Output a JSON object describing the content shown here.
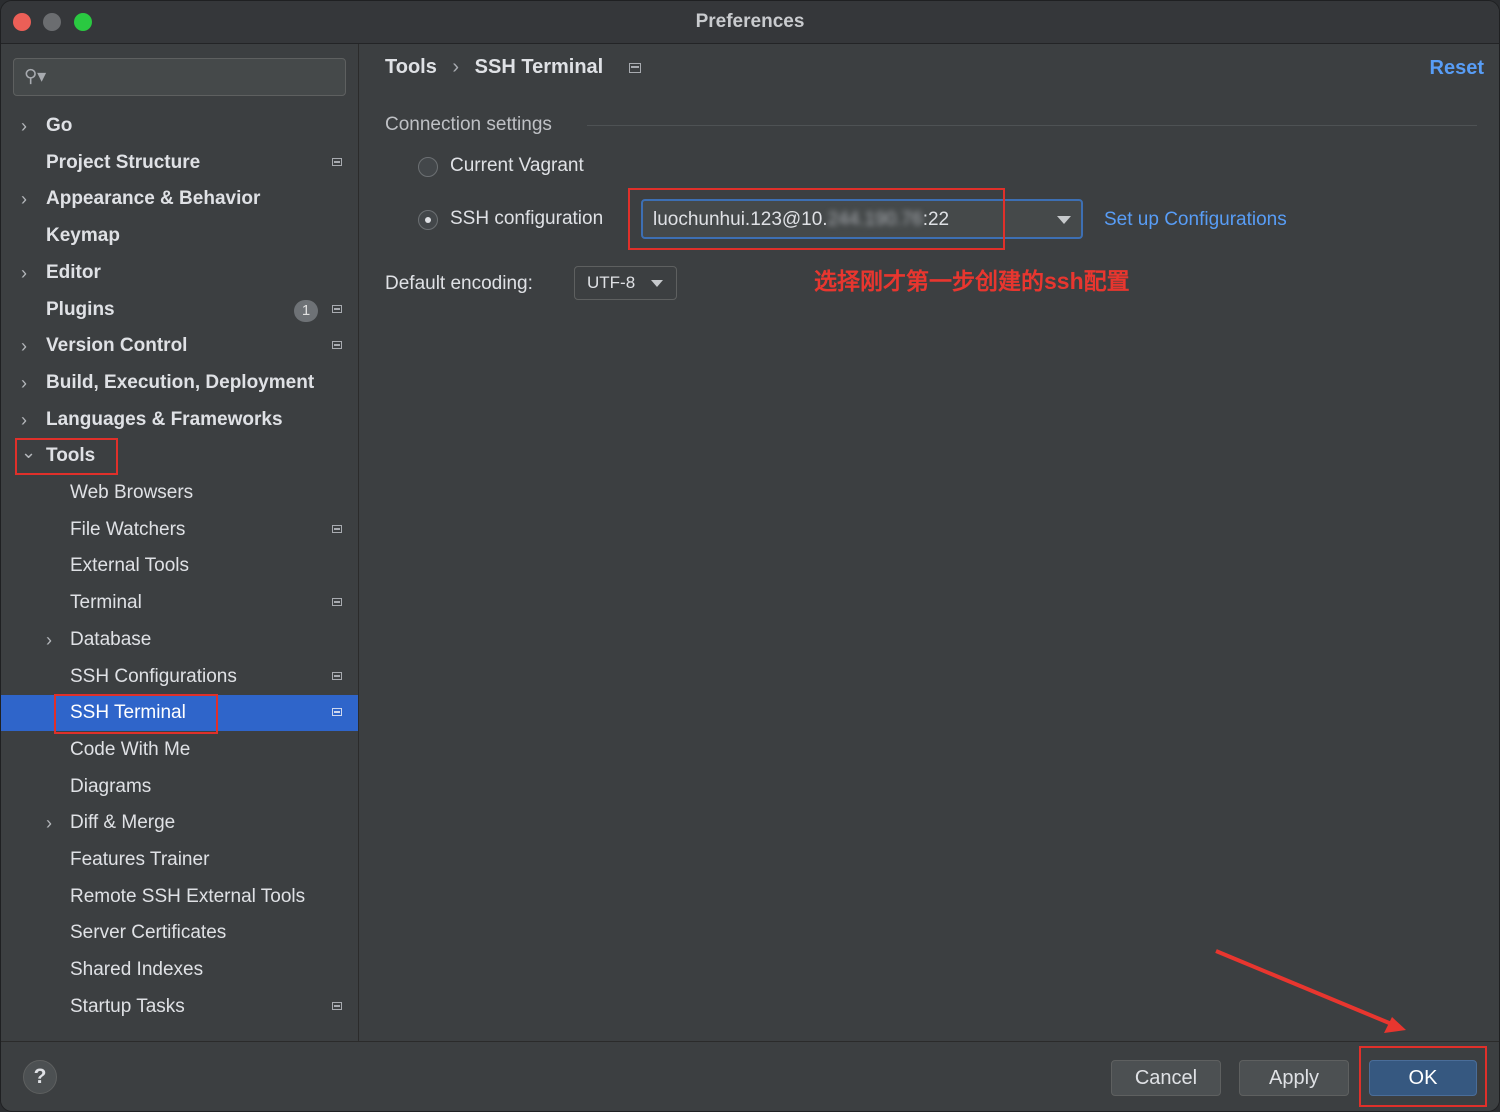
{
  "window": {
    "title": "Preferences"
  },
  "search": {
    "placeholder": ""
  },
  "sidebar": {
    "items": [
      {
        "label": "Go",
        "level": 0,
        "expander": "›",
        "icon": false
      },
      {
        "label": "Project Structure",
        "level": 0,
        "expander": "",
        "icon": true
      },
      {
        "label": "Appearance & Behavior",
        "level": 0,
        "expander": "›",
        "icon": false
      },
      {
        "label": "Keymap",
        "level": 0,
        "expander": "",
        "icon": false
      },
      {
        "label": "Editor",
        "level": 0,
        "expander": "›",
        "icon": false
      },
      {
        "label": "Plugins",
        "level": 0,
        "expander": "",
        "icon": true,
        "badge": "1"
      },
      {
        "label": "Version Control",
        "level": 0,
        "expander": "›",
        "icon": true
      },
      {
        "label": "Build, Execution, Deployment",
        "level": 0,
        "expander": "›",
        "icon": false
      },
      {
        "label": "Languages & Frameworks",
        "level": 0,
        "expander": "›",
        "icon": false
      },
      {
        "label": "Tools",
        "level": 0,
        "expander": "⌄",
        "icon": false
      },
      {
        "label": "Web Browsers",
        "level": 1,
        "expander": "",
        "icon": false
      },
      {
        "label": "File Watchers",
        "level": 1,
        "expander": "",
        "icon": true
      },
      {
        "label": "External Tools",
        "level": 1,
        "expander": "",
        "icon": false
      },
      {
        "label": "Terminal",
        "level": 1,
        "expander": "",
        "icon": true
      },
      {
        "label": "Database",
        "level": 1,
        "expander": "›",
        "icon": false
      },
      {
        "label": "SSH Configurations",
        "level": 1,
        "expander": "",
        "icon": true
      },
      {
        "label": "SSH Terminal",
        "level": 1,
        "expander": "",
        "icon": true,
        "selected": true
      },
      {
        "label": "Code With Me",
        "level": 1,
        "expander": "",
        "icon": false
      },
      {
        "label": "Diagrams",
        "level": 1,
        "expander": "",
        "icon": false
      },
      {
        "label": "Diff & Merge",
        "level": 1,
        "expander": "›",
        "icon": false
      },
      {
        "label": "Features Trainer",
        "level": 1,
        "expander": "",
        "icon": false
      },
      {
        "label": "Remote SSH External Tools",
        "level": 1,
        "expander": "",
        "icon": false
      },
      {
        "label": "Server Certificates",
        "level": 1,
        "expander": "",
        "icon": false
      },
      {
        "label": "Shared Indexes",
        "level": 1,
        "expander": "",
        "icon": false
      },
      {
        "label": "Startup Tasks",
        "level": 1,
        "expander": "",
        "icon": true
      }
    ]
  },
  "breadcrumb": {
    "parent": "Tools",
    "separator": "›",
    "current": "SSH Terminal"
  },
  "header": {
    "reset_label": "Reset"
  },
  "connection": {
    "section_title": "Connection settings",
    "option_vagrant": "Current Vagrant",
    "option_ssh": "SSH configuration",
    "selected_option": "ssh",
    "ssh_value_prefix": "luochunhui.123@10.",
    "ssh_value_hidden": "244.190.76",
    "ssh_value_suffix": ":22",
    "setup_link": "Set up Configurations"
  },
  "encoding": {
    "label": "Default encoding:",
    "value": "UTF-8"
  },
  "annotation": {
    "text": "选择刚才第一步创建的ssh配置"
  },
  "footer": {
    "help_label": "?",
    "cancel_label": "Cancel",
    "apply_label": "Apply",
    "ok_label": "OK"
  },
  "colors": {
    "accent": "#2f65ca",
    "link": "#589df6",
    "annotation": "#e8362f",
    "ok_button": "#365880"
  }
}
